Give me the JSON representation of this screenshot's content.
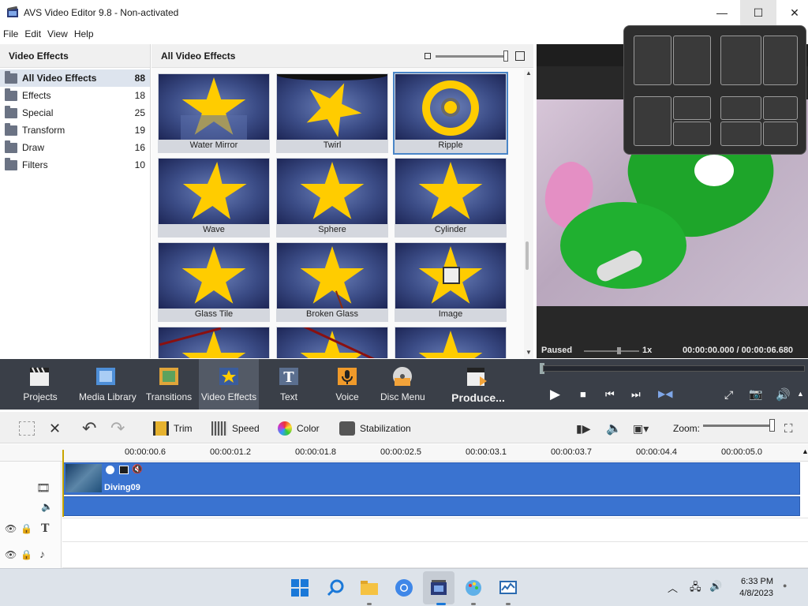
{
  "window": {
    "title": "AVS Video Editor 9.8 - Non-activated",
    "minimize_glyph": "—",
    "maximize_glyph": "☐",
    "close_glyph": "✕"
  },
  "menu": [
    "File",
    "Edit",
    "View",
    "Help"
  ],
  "left_panel": {
    "title": "Video Effects",
    "categories": [
      {
        "label": "All Video Effects",
        "count": "88",
        "selected": true
      },
      {
        "label": "Effects",
        "count": "18"
      },
      {
        "label": "Special",
        "count": "25"
      },
      {
        "label": "Transform",
        "count": "19"
      },
      {
        "label": "Draw",
        "count": "16"
      },
      {
        "label": "Filters",
        "count": "10"
      }
    ]
  },
  "grid": {
    "title": "All Video Effects",
    "tiles": [
      "Water Mirror",
      "Twirl",
      "Ripple",
      "Wave",
      "Sphere",
      "Cylinder",
      "Glass Tile",
      "Broken Glass",
      "Image"
    ],
    "selected": "Ripple"
  },
  "preview": {
    "status": "Paused",
    "speed": "1x",
    "time": "00:00:00.000 / 00:00:06.680"
  },
  "main_toolbar": {
    "buttons": [
      "Projects",
      "Media Library",
      "Transitions",
      "Video Effects",
      "Text",
      "Voice",
      "Disc Menu",
      "Produce..."
    ],
    "active": "Video Effects"
  },
  "edit_toolbar": {
    "trim": "Trim",
    "speed": "Speed",
    "color": "Color",
    "stabilization": "Stabilization",
    "zoom_label": "Zoom:"
  },
  "timeline": {
    "ruler": [
      "00:00:00.6",
      "00:00:01.2",
      "00:00:01.8",
      "00:00:02.5",
      "00:00:03.1",
      "00:00:03.7",
      "00:00:04.4",
      "00:00:05.0"
    ],
    "clip_name": "Diving09"
  },
  "taskbar": {
    "time": "6:33 PM",
    "date": "4/8/2023"
  },
  "colors": {
    "accent": "#3a73d0",
    "toolbar": "#3a3f48",
    "effect_star": "#ffcc00"
  }
}
